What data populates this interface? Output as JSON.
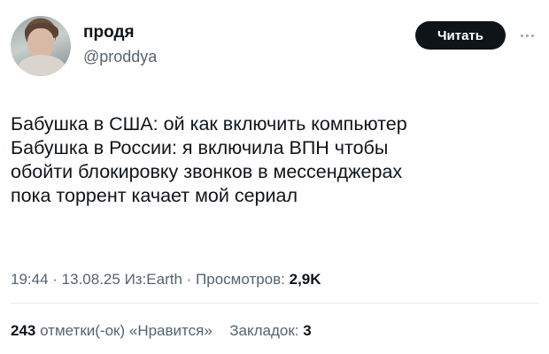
{
  "author": {
    "display_name": "продя",
    "handle": "@proddya"
  },
  "follow_button": {
    "label": "Читать"
  },
  "tweet": {
    "lines": [
      "Бабушка в США: ой как включить компьютер",
      "Бабушка в России: я включила ВПН чтобы",
      "обойти блокировку звонков в мессенджерах",
      "пока торрент качает мой сериал"
    ]
  },
  "meta": {
    "time": "19:44",
    "sep1": " · ",
    "date": "13.08.25",
    "source": " Из:Earth",
    "sep2": " · ",
    "views_label": "Просмотров: ",
    "views_count": "2,9K"
  },
  "stats": {
    "likes_count": "243",
    "likes_label": " отметки(-ок) «Нравится»",
    "bookmarks_label": "Закладок: ",
    "bookmarks_count": "3"
  },
  "icons": {
    "more": "more-horizontal-icon"
  },
  "colors": {
    "text_primary": "#0f1419",
    "text_secondary": "#536471",
    "button_bg": "#0f1419",
    "divider": "#e6e9ec"
  }
}
